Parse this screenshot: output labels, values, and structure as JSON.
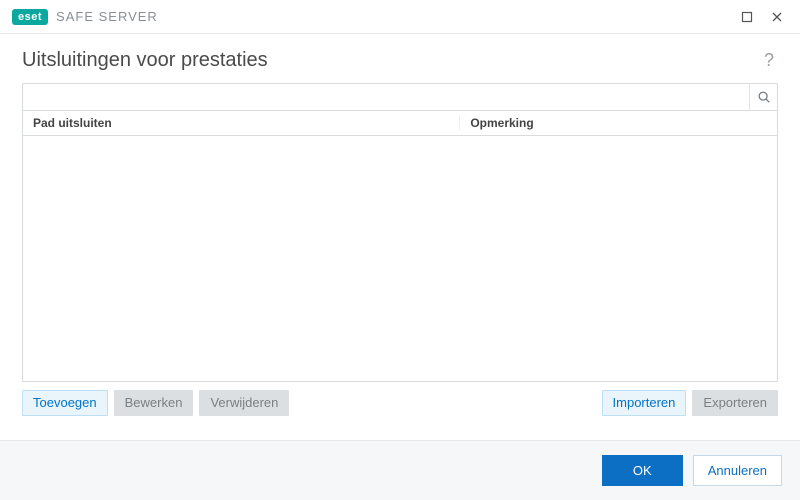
{
  "titlebar": {
    "brand": "eset",
    "product": "SAFE SERVER"
  },
  "header": {
    "title": "Uitsluitingen voor prestaties"
  },
  "search": {
    "placeholder": ""
  },
  "table": {
    "columns": [
      "Pad uitsluiten",
      "Opmerking"
    ],
    "rows": []
  },
  "actions": {
    "add": "Toevoegen",
    "edit": "Bewerken",
    "delete": "Verwijderen",
    "import": "Importeren",
    "export": "Exporteren"
  },
  "footer": {
    "ok": "OK",
    "cancel": "Annuleren"
  }
}
